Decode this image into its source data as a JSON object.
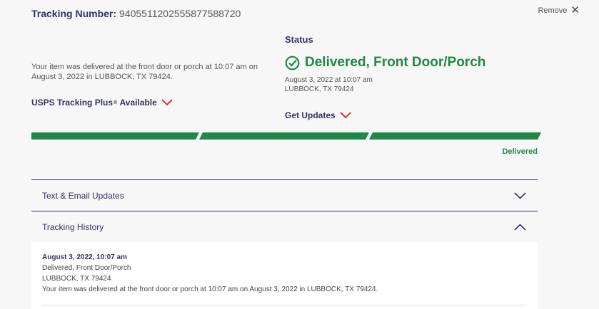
{
  "header": {
    "tracking_label": "Tracking Number:",
    "tracking_number": "9405511202555877588720",
    "remove_label": "Remove"
  },
  "summary": {
    "description": "Your item was delivered at the front door or porch at 10:07 am on August 3, 2022 in LUBBOCK, TX 79424.",
    "plus_label": "USPS Tracking Plus",
    "plus_mark": "®",
    "plus_suffix": "Available"
  },
  "status": {
    "heading": "Status",
    "main": "Delivered, Front Door/Porch",
    "date": "August 3, 2022 at 10:07 am",
    "location": "LUBBOCK, TX 79424",
    "get_updates_label": "Get Updates"
  },
  "progress": {
    "segments_total": 3,
    "segments_complete": 3,
    "label": "Delivered"
  },
  "accordion": {
    "text_email_label": "Text & Email Updates",
    "history_label": "Tracking History"
  },
  "history": [
    {
      "date": "August 3, 2022, 10:07 am",
      "status": "Delivered, Front Door/Porch",
      "location": "LUBBOCK, TX 79424",
      "detail": "Your item was delivered at the front door or porch at 10:07 am on August 3, 2022 in LUBBOCK, TX 79424."
    }
  ],
  "colors": {
    "navy": "#333366",
    "green": "#218748",
    "red": "#e71921",
    "background": "#f7f7f7"
  },
  "icons": {
    "status": "check-circle-icon",
    "expand": "chevron-down-icon",
    "collapse": "chevron-up-icon",
    "remove": "close-icon"
  }
}
